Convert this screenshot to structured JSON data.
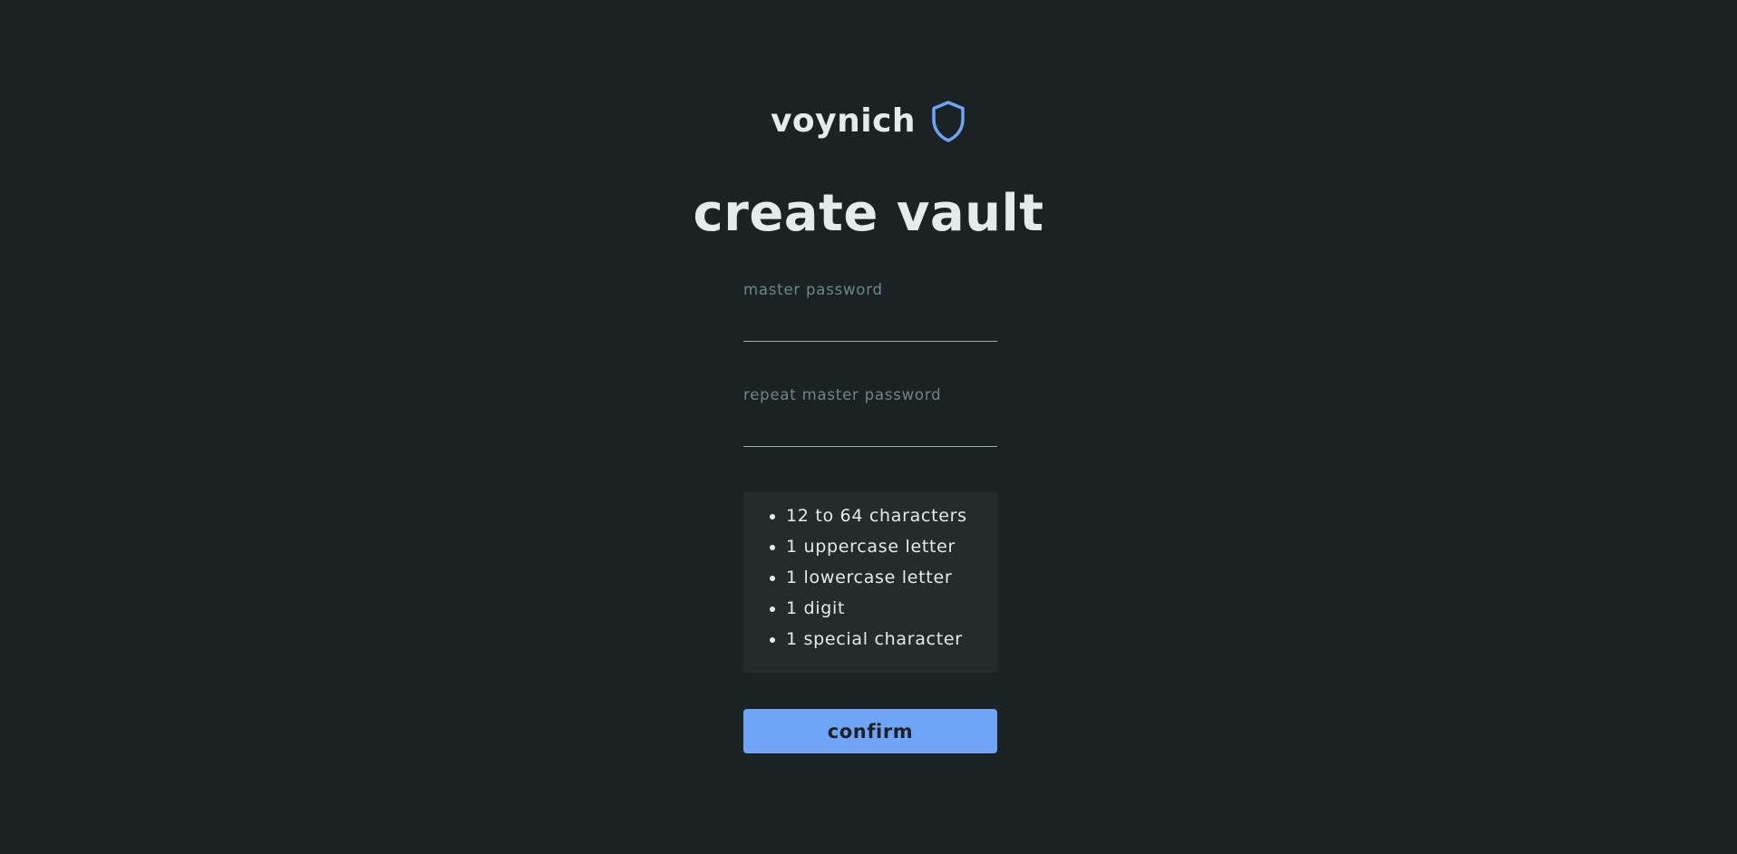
{
  "brand": {
    "name": "voynich",
    "icon": "shield-icon",
    "icon_color": "#6fa4f7"
  },
  "title": "create vault",
  "fields": {
    "master_password": {
      "label": "master password",
      "value": ""
    },
    "repeat_master_password": {
      "label": "repeat master password",
      "value": ""
    }
  },
  "requirements": [
    "12 to 64 characters",
    "1 uppercase letter",
    "1 lowercase letter",
    "1 digit",
    "1 special character"
  ],
  "confirm_label": "confirm",
  "colors": {
    "background": "#1b2223",
    "accent": "#6fa4f7",
    "text": "#e4ebec",
    "muted": "#6f8589",
    "panel": "#232b2d"
  }
}
